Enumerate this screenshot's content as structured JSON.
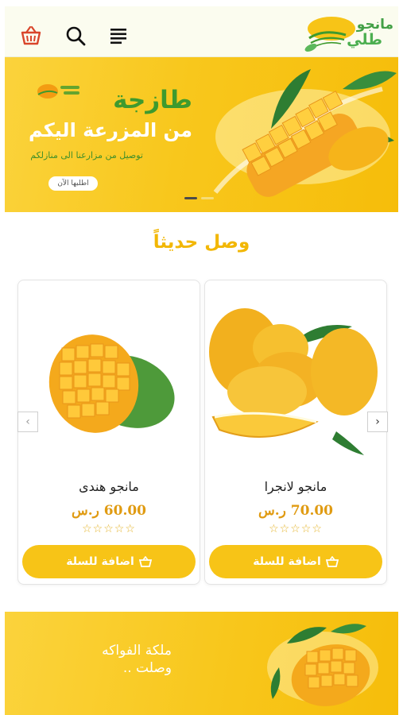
{
  "header": {
    "logo_line1": "مانجو",
    "logo_line2": "طلي",
    "icons": [
      "cart-basket-icon",
      "search-icon",
      "menu-icon"
    ]
  },
  "hero": {
    "title": "طازجة",
    "subtitle": "من المزرعة اليكم",
    "description": "توصيل من مزارعنا الى منازلكم",
    "button_label": "اطلبها الآن",
    "slides_count": 2,
    "active_slide": 1
  },
  "section": {
    "title": "وصل حديثاً"
  },
  "products": [
    {
      "name": "مانجو لانجرا",
      "price": "70.00 ر.س",
      "rating": "☆☆☆☆☆",
      "add_label": "اضافة للسلة"
    },
    {
      "name": "مانجو هندى",
      "price": "60.00 ر.س",
      "rating": "☆☆☆☆☆",
      "add_label": "اضافة للسلة"
    }
  ],
  "carousel": {
    "next_glyph": "›",
    "prev_glyph": "‹"
  },
  "banner2": {
    "text": "ملكة الفواكه\nوصلت .."
  },
  "colors": {
    "accent": "#f7c417",
    "brand_green": "#3e9a2e",
    "price": "#e09b12"
  }
}
